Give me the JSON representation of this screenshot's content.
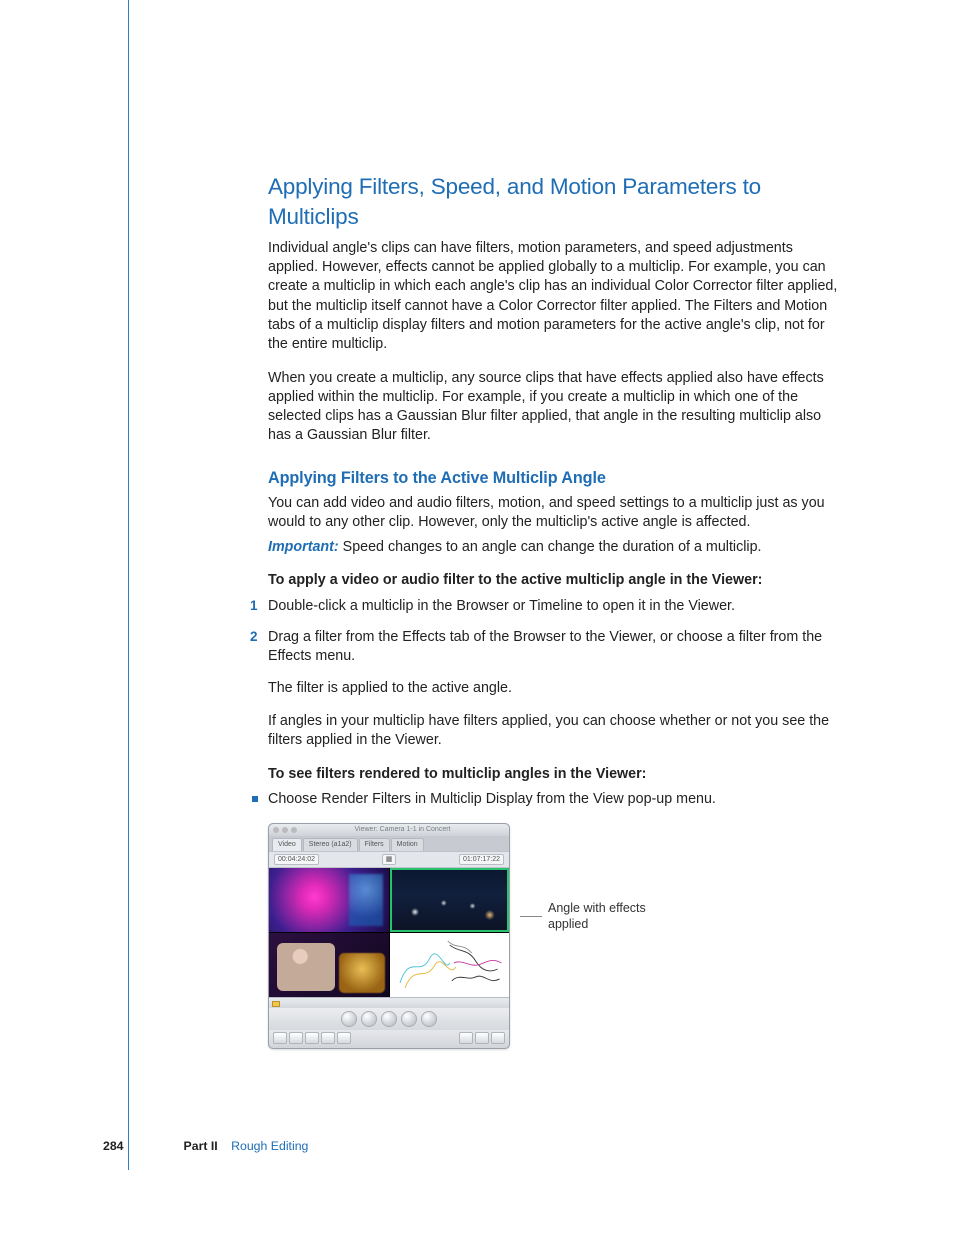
{
  "headings": {
    "main": "Applying Filters, Speed, and Motion Parameters to Multiclips",
    "sub1": "Applying Filters to the Active Multiclip Angle"
  },
  "paragraphs": {
    "p1": "Individual angle's clips can have filters, motion parameters, and speed adjustments applied. However, effects cannot be applied globally to a multiclip. For example, you can create a multiclip in which each angle's clip has an individual Color Corrector filter applied, but the multiclip itself cannot have a Color Corrector filter applied. The Filters and Motion tabs of a multiclip display filters and motion parameters for the active angle's clip, not for the entire multiclip.",
    "p2": "When you create a multiclip, any source clips that have effects applied also have effects applied within the multiclip. For example, if you create a multiclip in which one of the selected clips has a Gaussian Blur filter applied, that angle in the resulting multiclip also has a Gaussian Blur filter.",
    "p3": "You can add video and audio filters, motion, and speed settings to a multiclip just as you would to any other clip. However, only the multiclip's active angle is affected.",
    "important_label": "Important:  ",
    "important_text": "Speed changes to an angle can change the duration of a multiclip.",
    "task1_title": "To apply a video or audio filter to the active multiclip angle in the Viewer:",
    "step1": "Double-click a multiclip in the Browser or Timeline to open it in the Viewer.",
    "step2": "Drag a filter from the Effects tab of the Browser to the Viewer, or choose a filter from the Effects menu.",
    "step_result": "The filter is applied to the active angle.",
    "p4": "If angles in your multiclip have filters applied, you can choose whether or not you see the filters applied in the Viewer.",
    "task2_title": "To see filters rendered to multiclip angles in the Viewer:",
    "bullet1": "Choose Render Filters in Multiclip Display from the View pop-up menu."
  },
  "step_numbers": {
    "n1": "1",
    "n2": "2"
  },
  "viewer": {
    "title": "Viewer: Camera 1-1 in Concert",
    "tabs": {
      "video": "Video",
      "stereo": "Stereo (a1a2)",
      "filters": "Filters",
      "motion": "Motion"
    },
    "tc_left": "00:04:24:02",
    "tc_right": "01:07:17:22"
  },
  "callout": {
    "line1": "Angle with effects",
    "line2": "applied"
  },
  "footer": {
    "page": "284",
    "part_label": "Part II",
    "section": "Rough Editing"
  }
}
